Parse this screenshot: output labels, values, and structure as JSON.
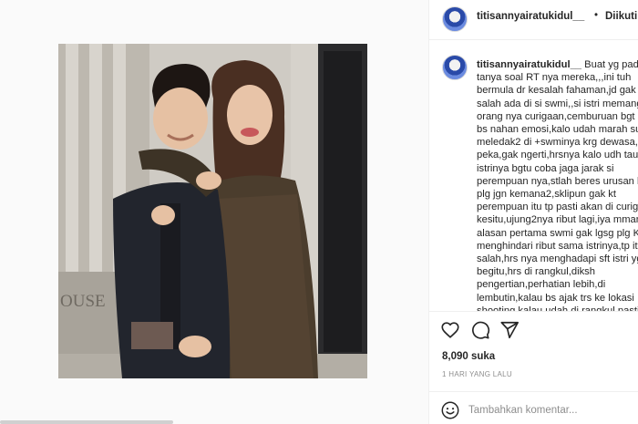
{
  "post": {
    "username": "titisannyairatukidul__",
    "dot": "•",
    "follow_status": "Diikuti",
    "caption_username": "titisannyairatukidul__",
    "caption_text": " Buat yg pada tanya soal RT nya mereka,,,ini tuh bermula dr kesalah fahaman,jd gak salah ada di si swmi,,si istri memang orang nya curigaan,cemburuan bgt gak bs nahan emosi,kalo udah marah suka meledak2 di +swminya krg dewasa,gk peka,gak ngerti,hrsnya kalo udh tau istrinya bgtu coba jaga jarak si perempuan nya,stlah beres urusan lgsg plg jgn kemana2,sklipun gak kt perempuan itu tp pasti akan di curigai kesitu,ujung2nya ribut lagi,iya mmang alasan pertama swmi gak lgsg plg Krn menghindari ribut sama istrinya,tp itu salah,hrs nya menghadapi sft istri yg begitu,hrs di rangkul,diksh pengertian,perhatian lebih,di lembutin,kalau bs ajak trs ke lokasi shooting,kalau udah di rangkul pasti",
    "likes": "8,090 suka",
    "timestamp": "1 HARI YANG LALU",
    "comment_placeholder": "Tambahkan komentar..."
  },
  "icons": {
    "heart": "heart-icon",
    "comment": "comment-icon",
    "share": "share-icon",
    "emoji": "emoji-icon"
  },
  "colors": {
    "text": "#262626",
    "muted": "#8e8e8e",
    "border": "#efefef",
    "media_background": "#fafafa"
  }
}
